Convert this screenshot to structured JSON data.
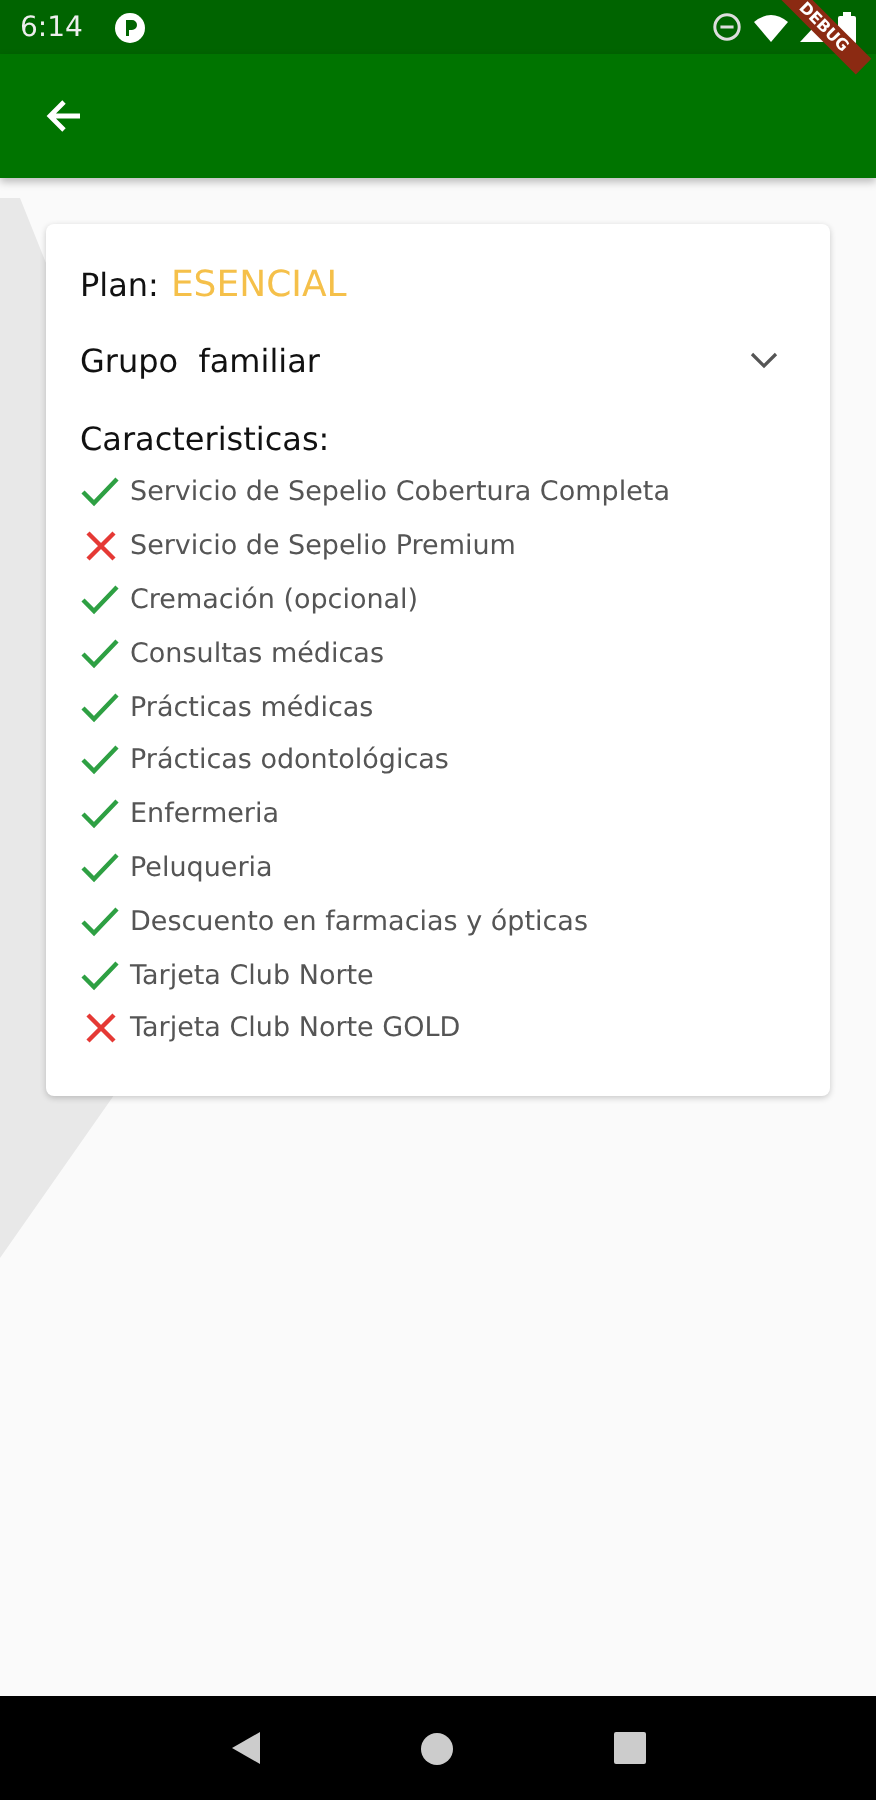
{
  "status_bar": {
    "time": "6:14"
  },
  "debug_banner": {
    "label": "DEBUG"
  },
  "plan": {
    "label": "Plan:",
    "name": "ESENCIAL"
  },
  "dropdown": {
    "label": "Grupo  familiar",
    "expanded": false
  },
  "features": {
    "title": "Caracteristicas:",
    "items": [
      {
        "label": "Servicio de Sepelio Cobertura Completa",
        "included": true
      },
      {
        "label": "Servicio de Sepelio Premium",
        "included": false
      },
      {
        "label": "Cremación (opcional)",
        "included": true
      },
      {
        "label": "Consultas médicas",
        "included": true
      },
      {
        "label": "Prácticas médicas",
        "included": true
      },
      {
        "label": "Prácticas odontológicas",
        "included": true
      },
      {
        "label": "Enfermeria",
        "included": true
      },
      {
        "label": "Peluqueria",
        "included": true
      },
      {
        "label": "Descuento en farmacias y ópticas",
        "included": true
      },
      {
        "label": "Tarjeta Club Norte",
        "included": true
      },
      {
        "label": "Tarjeta Club Norte GOLD",
        "included": false
      }
    ]
  }
}
